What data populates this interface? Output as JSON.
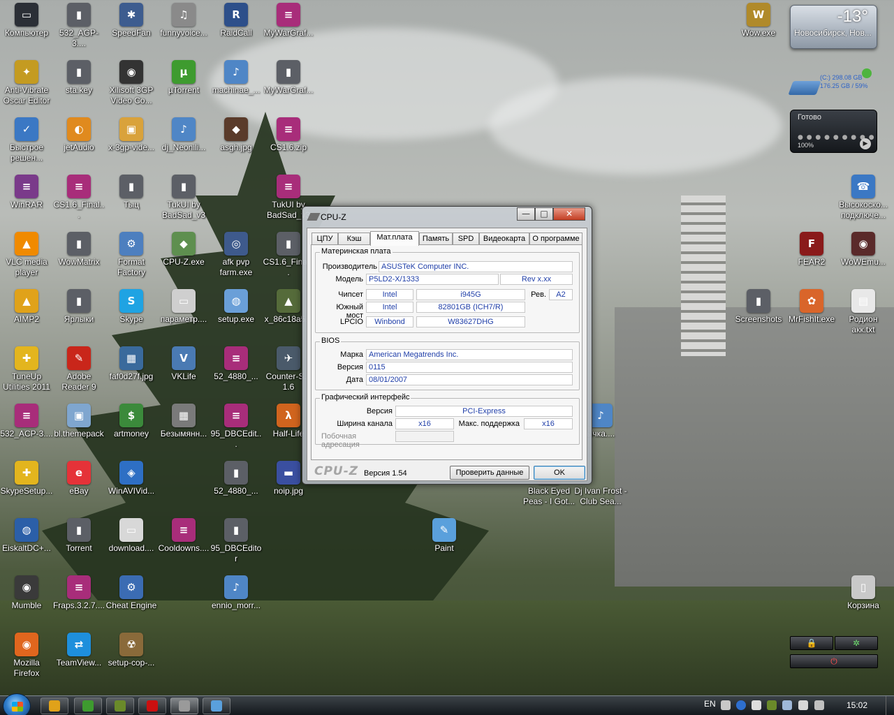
{
  "desktop": {
    "icons": [
      {
        "label": "Компьютер",
        "glyph": "▭",
        "color": "#2b2f36"
      },
      {
        "label": "532_AGP-3....",
        "glyph": "▮",
        "color": "#5c5f66"
      },
      {
        "label": "SpeedFan",
        "glyph": "✱",
        "color": "#3d5c8f"
      },
      {
        "label": "funnyvoice...",
        "glyph": "♫",
        "color": "#8a8a8a"
      },
      {
        "label": "RaidCall",
        "glyph": "R",
        "color": "#2d4f8a"
      },
      {
        "label": "MyWarGraf...",
        "glyph": "≡",
        "color": "#a82d7a"
      },
      {
        "label": "Anti-Vibrate Oscar Editor",
        "glyph": "✦",
        "color": "#c49b21"
      },
      {
        "label": "sta.key",
        "glyph": "▮",
        "color": "#5c5f66"
      },
      {
        "label": "Xilisoft 3GP Video Co...",
        "glyph": "◉",
        "color": "#333333"
      },
      {
        "label": "µTorrent",
        "glyph": "µ",
        "color": "#3e9b2f"
      },
      {
        "label": "machinae_...",
        "glyph": "♪",
        "color": "#4f86c6"
      },
      {
        "label": "MyWarGraf...",
        "glyph": "▮",
        "color": "#5c5f66"
      },
      {
        "label": "Быстрое решен...",
        "glyph": "✓",
        "color": "#3b78c4"
      },
      {
        "label": "jetAudio",
        "glyph": "◐",
        "color": "#e08a1e"
      },
      {
        "label": "x-3gp-vide...",
        "glyph": "▣",
        "color": "#d9a23b"
      },
      {
        "label": "dj_Neonili...",
        "glyph": "♪",
        "color": "#4f86c6"
      },
      {
        "label": "asgh.jpg",
        "glyph": "◆",
        "color": "#5a3b2a"
      },
      {
        "label": "CS1.6.zip",
        "glyph": "≡",
        "color": "#a82d7a"
      },
      {
        "label": "WinRAR",
        "glyph": "≡",
        "color": "#7a3a8a"
      },
      {
        "label": "CS1.6_Final...",
        "glyph": "≡",
        "color": "#a82d7a"
      },
      {
        "label": "Тыц",
        "glyph": "▮",
        "color": "#5c5f66"
      },
      {
        "label": "TukUI by BadSad_v3",
        "glyph": "▮",
        "color": "#5c5f66"
      },
      {
        "label": "TukUI by BadSad_v3",
        "glyph": "≡",
        "color": "#a82d7a"
      },
      {
        "label": "VLC media player",
        "glyph": "▲",
        "color": "#f08a00"
      },
      {
        "label": "WowMatrix",
        "glyph": "▮",
        "color": "#5c5f66"
      },
      {
        "label": "Format Factory",
        "glyph": "⚙",
        "color": "#4d7fbf"
      },
      {
        "label": "CPU-Z.exe",
        "glyph": "◆",
        "color": "#5e8f4f"
      },
      {
        "label": "afk pvp farm.exe",
        "glyph": "◎",
        "color": "#3e5a8c"
      },
      {
        "label": "CS1.6_Final...",
        "glyph": "▮",
        "color": "#5c5f66"
      },
      {
        "label": "AIMP2",
        "glyph": "▲",
        "color": "#e0a21a"
      },
      {
        "label": "Ярлыки",
        "glyph": "▮",
        "color": "#5c5f66"
      },
      {
        "label": "Skype",
        "glyph": "S",
        "color": "#1fa3e3"
      },
      {
        "label": "параметр....",
        "glyph": "▭",
        "color": "#cfcfcf"
      },
      {
        "label": "setup.exe",
        "glyph": "◍",
        "color": "#6a9fd8"
      },
      {
        "label": "x_86c18a5...",
        "glyph": "▲",
        "color": "#556b3a"
      },
      {
        "label": "TuneUp Utilities 2011",
        "glyph": "✚",
        "color": "#e3b51e"
      },
      {
        "label": "Adobe Reader 9",
        "glyph": "✎",
        "color": "#c9261a"
      },
      {
        "label": "faf0d27f.jpg",
        "glyph": "▦",
        "color": "#3a6a9c"
      },
      {
        "label": "VKLife",
        "glyph": "V",
        "color": "#4a7ab3"
      },
      {
        "label": "52_4880_...",
        "glyph": "≡",
        "color": "#a82d7a"
      },
      {
        "label": "Counter-S... 1.6",
        "glyph": "✈",
        "color": "#4a5a6a"
      },
      {
        "label": "532_ACP-3....",
        "glyph": "≡",
        "color": "#a82d7a"
      },
      {
        "label": "bl.themepack",
        "glyph": "▣",
        "color": "#7fa6cf"
      },
      {
        "label": "artmoney",
        "glyph": "$",
        "color": "#3b8a3b"
      },
      {
        "label": "Безымянн...",
        "glyph": "▦",
        "color": "#7a7a7a"
      },
      {
        "label": "95_DBCEdit...",
        "glyph": "≡",
        "color": "#a82d7a"
      },
      {
        "label": "Half-Life",
        "glyph": "λ",
        "color": "#d0641e"
      },
      {
        "label": "SkypeSetup...",
        "glyph": "✚",
        "color": "#e3b51e"
      },
      {
        "label": "eBay",
        "glyph": "e",
        "color": "#e53238"
      },
      {
        "label": "WinAVIVid...",
        "glyph": "◈",
        "color": "#2e6fc4"
      },
      {
        "label": "52_4880_...",
        "glyph": "▮",
        "color": "#5c5f66"
      },
      {
        "label": "noip.jpg",
        "glyph": "▬",
        "color": "#3a4fa0"
      },
      {
        "label": "EiskaltDC+...",
        "glyph": "◍",
        "color": "#2b5fa8"
      },
      {
        "label": "Torrent",
        "glyph": "▮",
        "color": "#5c5f66"
      },
      {
        "label": "download....",
        "glyph": "▭",
        "color": "#d8d8d8"
      },
      {
        "label": "Cooldowns....",
        "glyph": "≡",
        "color": "#a82d7a"
      },
      {
        "label": "95_DBCEditor",
        "glyph": "▮",
        "color": "#5c5f66"
      },
      {
        "label": "Paint",
        "glyph": "✎",
        "color": "#5aa0dc"
      },
      {
        "label": "Mumble",
        "glyph": "◉",
        "color": "#3a3a3a"
      },
      {
        "label": "Fraps.3.2.7....",
        "glyph": "≡",
        "color": "#a82d7a"
      },
      {
        "label": "Cheat Engine",
        "glyph": "⚙",
        "color": "#3b6cb3"
      },
      {
        "label": "ennio_morr...",
        "glyph": "♪",
        "color": "#4f86c6"
      },
      {
        "label": "Mozilla Firefox",
        "glyph": "◉",
        "color": "#e0661e"
      },
      {
        "label": "TeamView...",
        "glyph": "⇄",
        "color": "#1e8fdc"
      },
      {
        "label": "setup-cop-...",
        "glyph": "☢",
        "color": "#8a6a3a"
      },
      {
        "label": "ычка....",
        "glyph": "♪",
        "color": "#4f86c6"
      },
      {
        "label": "Black Eyed Peas - I Got...",
        "glyph": "▦",
        "color": "#b0402a"
      },
      {
        "label": "Dj Ivan Frost - Club Sea...",
        "glyph": "",
        "color": "transparent"
      },
      {
        "label": "Wow.exe",
        "glyph": "W",
        "color": "#b08a2a"
      },
      {
        "label": "Высокоско... подключе...",
        "glyph": "☎",
        "color": "#3b78c4"
      },
      {
        "label": "FEAR2",
        "glyph": "F",
        "color": "#8a1a1a"
      },
      {
        "label": "WoWEmu...",
        "glyph": "◉",
        "color": "#5a2a2a"
      },
      {
        "label": "Screenshots",
        "glyph": "▮",
        "color": "#5c5f66"
      },
      {
        "label": "MrFishIt.exe",
        "glyph": "✿",
        "color": "#d9652a"
      },
      {
        "label": "Родион акк.txt",
        "glyph": "▤",
        "color": "#e8e8e8"
      },
      {
        "label": "Корзина",
        "glyph": "▯",
        "color": "#c9c9c9"
      }
    ]
  },
  "gadgets": {
    "weather": {
      "temp": "-13°",
      "city": "Новосибирск, Нов..."
    },
    "drive": {
      "line1": "(C:) 298.08 GB",
      "line2": "176.25 GB / 59%"
    },
    "media": {
      "status": "Готово",
      "dots": "● ● ● ● ● ● ● ● ●",
      "volume": "100%",
      "play": "▶"
    },
    "lock": {
      "lock_icon": "🔒",
      "spin_icon": "✲",
      "power_icon": "⏻"
    }
  },
  "cpuz": {
    "title": "CPU-Z",
    "controls": {
      "min": "—",
      "max": "□",
      "close": "✕"
    },
    "tabs": [
      "ЦПУ",
      "Кэш",
      "Мат.плата",
      "Память",
      "SPD",
      "Видеокарта",
      "О программе"
    ],
    "active_tab": "Мат.плата",
    "mainboard": {
      "group_title": "Материнская плата",
      "manufacturer_label": "Производитель",
      "manufacturer": "ASUSTeK Computer INC.",
      "model_label": "Модель",
      "model": "P5LD2-X/1333",
      "model_rev": "Rev x.xx",
      "chipset_label": "Чипсет",
      "chipset_vendor": "Intel",
      "chipset": "i945G",
      "rev_label": "Рев.",
      "chipset_rev": "A2",
      "southbridge_label": "Южный мост",
      "southbridge_vendor": "Intel",
      "southbridge": "82801GB (ICH7/R)",
      "lpcio_label": "LPCIO",
      "lpcio_vendor": "Winbond",
      "lpcio": "W83627DHG"
    },
    "bios": {
      "group_title": "BIOS",
      "brand_label": "Марка",
      "brand": "American Megatrends Inc.",
      "version_label": "Версия",
      "version": "0115",
      "date_label": "Дата",
      "date": "08/01/2007"
    },
    "graphic": {
      "group_title": "Графический интерфейс",
      "version_label": "Версия",
      "version": "PCI-Express",
      "width_label": "Ширина канала",
      "width": "x16",
      "max_label": "Макс. поддержка",
      "max": "x16",
      "sideband_label": "Побочная адресация",
      "sideband": ""
    },
    "footer": {
      "logo": "CPU-Z",
      "version": "Версия 1.54",
      "validate": "Проверить данные",
      "ok": "OK"
    }
  },
  "taskbar": {
    "apps": [
      {
        "name": "media-player",
        "color": "#e0a21a"
      },
      {
        "name": "utorrent",
        "color": "#3e9b2f"
      },
      {
        "name": "plant",
        "color": "#6a8a2a"
      },
      {
        "name": "opera",
        "color": "#cc1010"
      },
      {
        "name": "cpu-z",
        "color": "#9a9a9a"
      },
      {
        "name": "paint",
        "color": "#5aa0dc"
      }
    ],
    "lang": "EN",
    "clock": "15:02"
  }
}
